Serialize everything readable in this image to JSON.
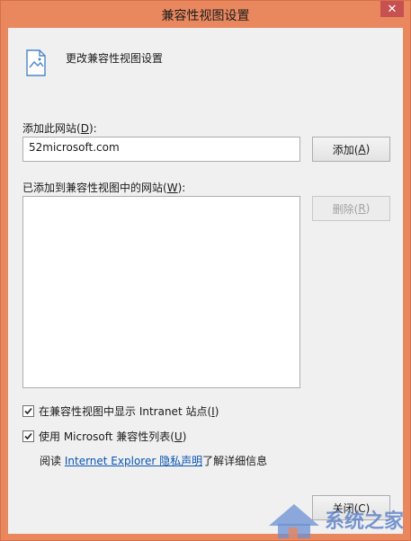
{
  "window": {
    "title": "兼容性视图设置"
  },
  "header": {
    "text": "更改兼容性视图设置"
  },
  "add_site": {
    "label": "添加此网站(D):",
    "label_prefix": "添加此网站(",
    "label_key": "D",
    "label_suffix": "):",
    "value": "52microsoft.com",
    "button_label": "添加(A)",
    "button_prefix": "添加(",
    "button_key": "A",
    "button_suffix": ")"
  },
  "added_sites": {
    "label": "已添加到兼容性视图中的网站(W):",
    "label_prefix": "已添加到兼容性视图中的网站(",
    "label_key": "W",
    "label_suffix": "):",
    "items": [],
    "remove_button_label": "删除(R)",
    "remove_prefix": "删除(",
    "remove_key": "R",
    "remove_suffix": ")"
  },
  "options": {
    "intranet": {
      "label": "在兼容性视图中显示 Intranet 站点(I)",
      "prefix": "在兼容性视图中显示 Intranet 站点(",
      "key": "I",
      "suffix": ")",
      "checked": true
    },
    "ms_list": {
      "label": "使用 Microsoft 兼容性列表(U)",
      "prefix": "使用 Microsoft 兼容性列表(",
      "key": "U",
      "suffix": ")",
      "checked": true
    }
  },
  "privacy": {
    "read": "阅读",
    "link": "Internet Explorer 隐私声明",
    "suffix": "了解详细信息"
  },
  "footer": {
    "close_button_label": "关闭(C)"
  },
  "watermark": {
    "text": "系统之家"
  }
}
